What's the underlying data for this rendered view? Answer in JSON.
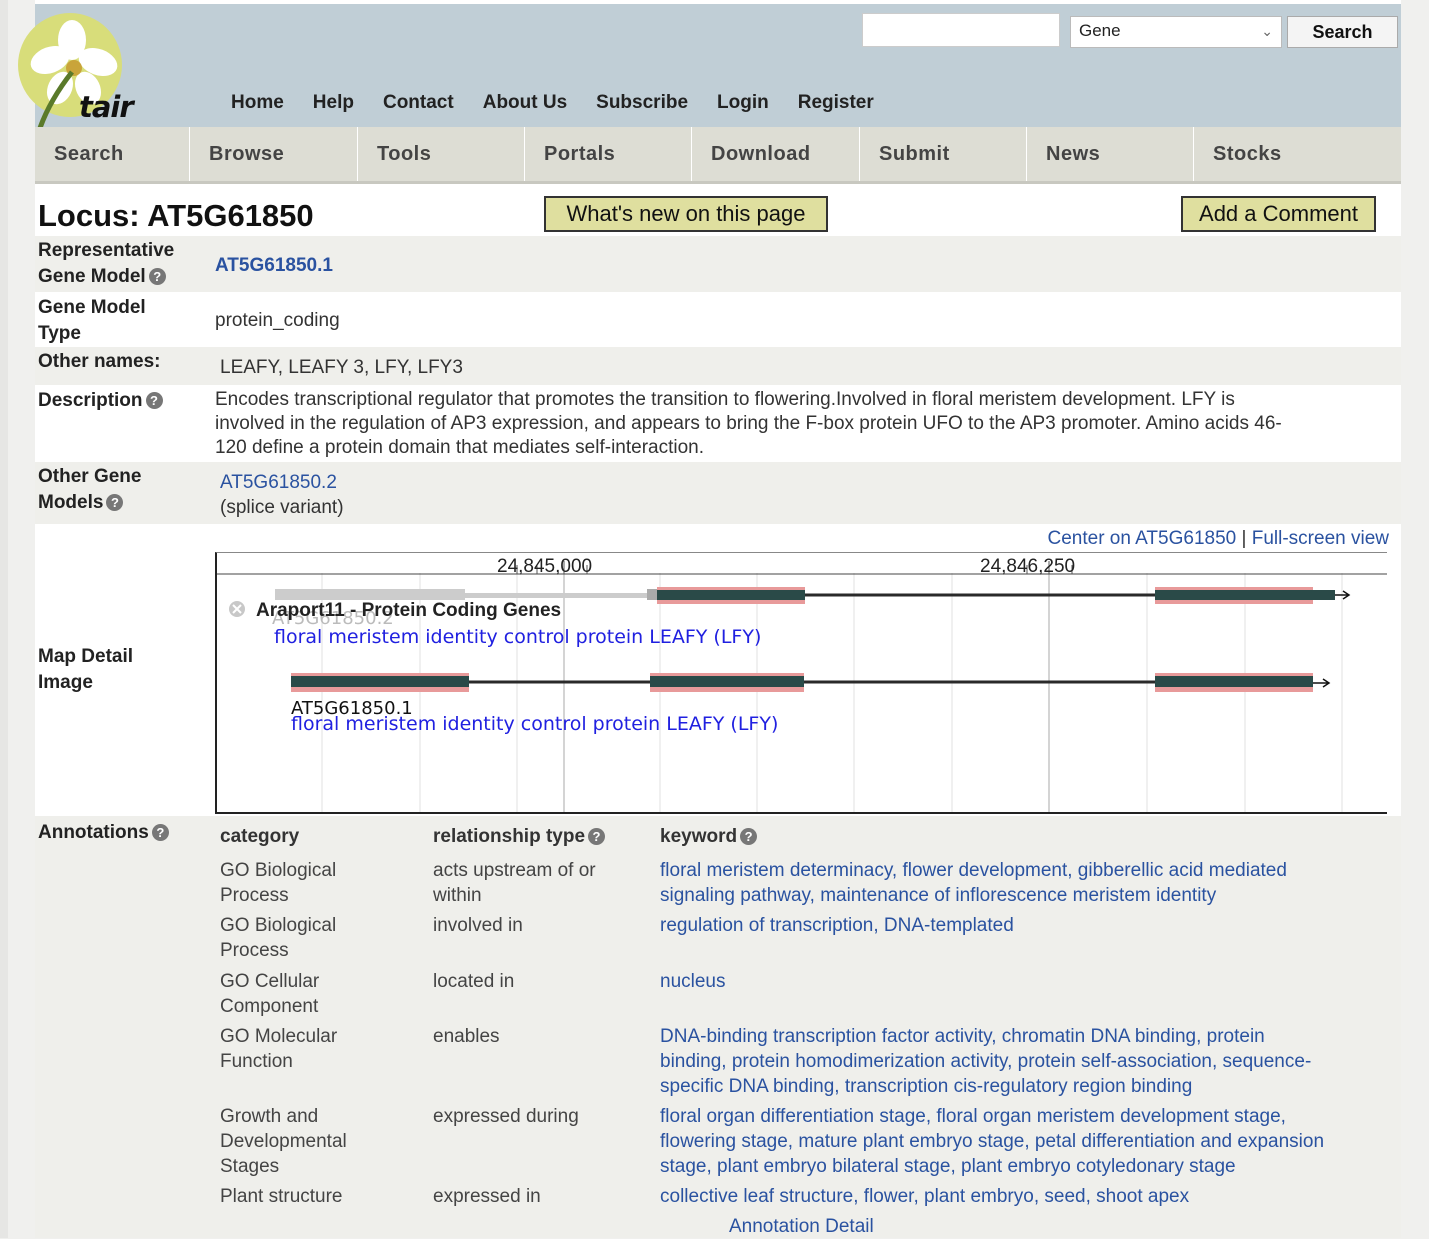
{
  "header": {
    "logo_text": "tair",
    "search_value": "",
    "search_type_selected": "Gene",
    "search_button": "Search",
    "top_nav": [
      "Home",
      "Help",
      "Contact",
      "About Us",
      "Subscribe",
      "Login",
      "Register"
    ]
  },
  "main_nav": [
    "Search",
    "Browse",
    "Tools",
    "Portals",
    "Download",
    "Submit",
    "News",
    "Stocks"
  ],
  "locus": {
    "title": "Locus: AT5G61850",
    "whats_new_button": "What's new on this page",
    "add_comment_button": "Add a Comment"
  },
  "fields": {
    "rep_model_label_1": "Representative",
    "rep_model_label_2": "Gene Model",
    "rep_model_value": "AT5G61850.1",
    "type_label_1": "Gene Model",
    "type_label_2": "Type",
    "type_value": "protein_coding",
    "other_names_label": "Other names:",
    "other_names_value": "LEAFY, LEAFY 3, LFY, LFY3",
    "description_label": "Description",
    "description_lines": [
      "Encodes transcriptional regulator that promotes the transition to flowering.Involved in floral meristem development. LFY is",
      "involved in the regulation of AP3 expression, and appears to bring the F-box protein UFO to the AP3 promoter. Amino acids 46-",
      "120 define a protein domain that mediates self-interaction."
    ],
    "other_models_label_1": "Other Gene",
    "other_models_label_2": "Models",
    "other_models_link": "AT5G61850.2",
    "other_models_note": "(splice variant)",
    "map_label_1": "Map Detail",
    "map_label_2": "Image"
  },
  "map": {
    "center_link": "Center on AT5G61850",
    "separator": "|",
    "fullscreen_link": "Full-screen view",
    "ruler_labels": [
      "24,845,000",
      "24,846,250"
    ],
    "track_title": "Araport11 - Protein Coding Genes",
    "model1_name": "AT5G61850.2",
    "model1_desc": "floral meristem identity control protein LEAFY (LFY)",
    "model2_name": "AT5G61850.1",
    "model2_desc": "floral meristem identity control protein LEAFY (LFY)"
  },
  "annotations": {
    "label": "Annotations",
    "headers": {
      "category": "category",
      "relationship": "relationship type",
      "keyword": "keyword"
    },
    "rows": [
      {
        "cat1": "GO Biological",
        "cat2": "Process",
        "cat3": "",
        "rel1": "acts upstream of or",
        "rel2": "within",
        "kw": [
          "floral meristem determinacy, flower development, gibberellic acid mediated",
          "signaling pathway, maintenance of inflorescence meristem identity",
          ""
        ]
      },
      {
        "cat1": "GO Biological",
        "cat2": "Process",
        "cat3": "",
        "rel1": "involved in",
        "rel2": "",
        "kw": [
          "regulation of transcription, DNA-templated",
          "",
          ""
        ]
      },
      {
        "cat1": "GO Cellular",
        "cat2": "Component",
        "cat3": "",
        "rel1": "located in",
        "rel2": "",
        "kw": [
          "nucleus",
          "",
          ""
        ]
      },
      {
        "cat1": "GO Molecular",
        "cat2": "Function",
        "cat3": "",
        "rel1": "enables",
        "rel2": "",
        "kw": [
          "DNA-binding transcription factor activity, chromatin DNA binding, protein",
          "binding, protein homodimerization activity, protein self-association, sequence-",
          "specific DNA binding, transcription cis-regulatory region binding"
        ]
      },
      {
        "cat1": "Growth and",
        "cat2": "Developmental",
        "cat3": "Stages",
        "rel1": "expressed during",
        "rel2": "",
        "kw": [
          "floral organ differentiation stage, floral organ meristem development stage,",
          "flowering stage, mature plant embryo stage, petal differentiation and expansion",
          "stage, plant embryo bilateral stage, plant embryo cotyledonary stage"
        ]
      },
      {
        "cat1": "Plant structure",
        "cat2": "",
        "cat3": "",
        "rel1": "expressed in",
        "rel2": "",
        "kw": [
          "collective leaf structure, flower, plant embryo, seed, shoot apex",
          "",
          ""
        ]
      }
    ],
    "detail_link": "Annotation Detail"
  },
  "colors": {
    "header_bg": "#c0ced6",
    "nav_bg": "#ddddd4",
    "button_bg": "#dfdf9f",
    "link": "#2a52a0",
    "exon": "#2a4a48",
    "utr": "#e89a9a"
  }
}
